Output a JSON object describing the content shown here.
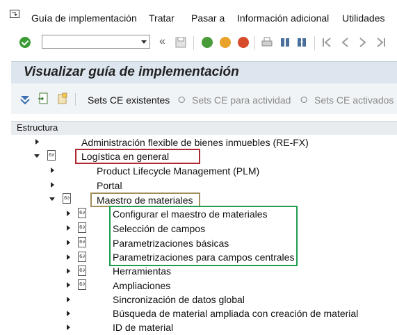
{
  "menu": {
    "items": [
      "Guía de implementación",
      "Tratar",
      "Pasar a",
      "Información adicional",
      "Utilidades"
    ]
  },
  "title": "Visualizar guía de implementación",
  "app_toolbar": {
    "sets_ce_existentes": "Sets CE existentes",
    "sets_ce_actividad": "Sets CE para actividad",
    "sets_ce_activados": "Sets CE activados p"
  },
  "tree": {
    "header": "Estructura",
    "nodes": [
      "Administración flexible de bienes inmuebles (RE-FX)",
      "Logística en general",
      "Product Lifecycle Management (PLM)",
      "Portal",
      "Maestro de materiales",
      "Configurar el maestro de materiales",
      "Selección de campos",
      "Parametrizaciones básicas",
      "Parametrizaciones para campos centrales",
      "Herramientas",
      "Ampliaciones",
      "Sincronización de datos global",
      "Búsqueda de material ampliada con creación de material",
      "ID de material"
    ]
  },
  "colors": {
    "highlight_red": "#b0282f",
    "highlight_olive": "#a08d5a",
    "highlight_green": "#1f9e4e"
  }
}
